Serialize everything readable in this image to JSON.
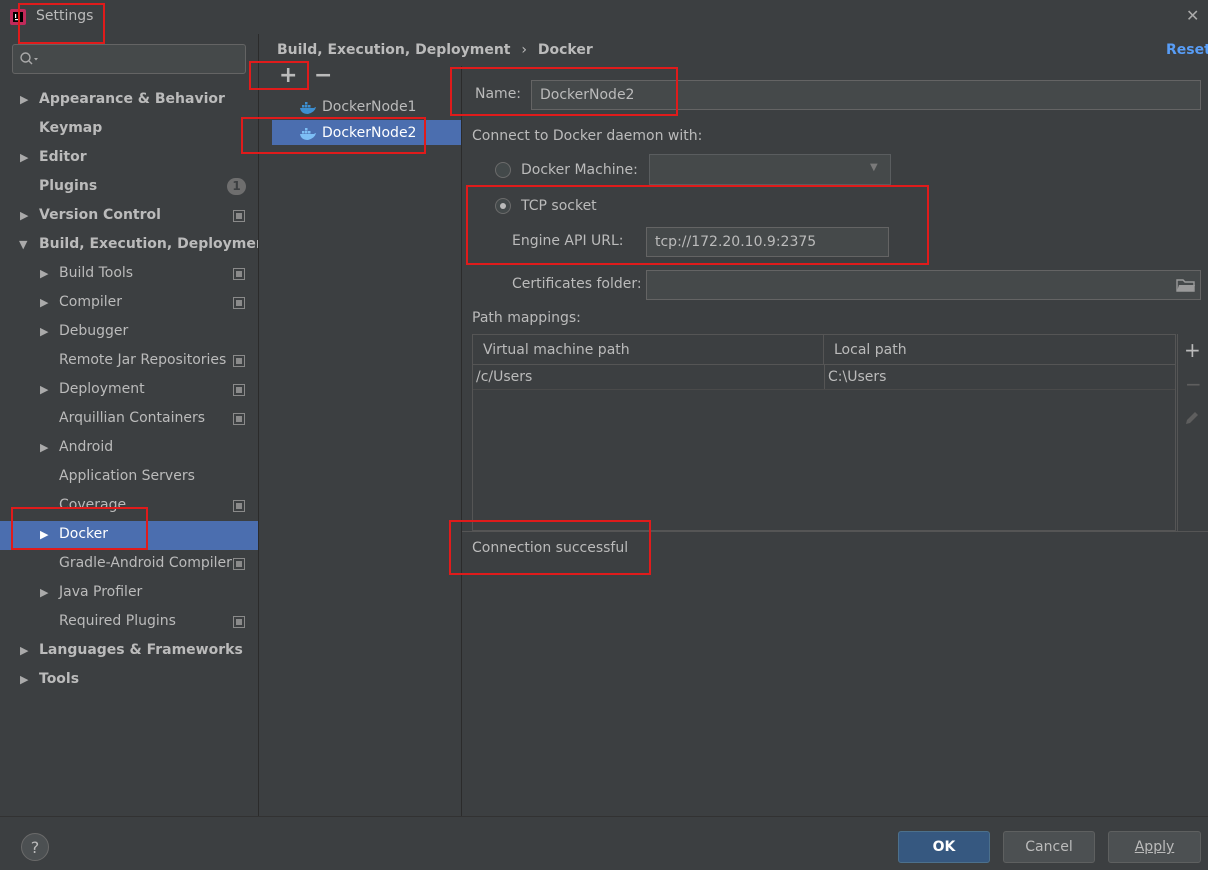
{
  "window": {
    "title": "Settings",
    "close_glyph": "✕"
  },
  "search": {
    "placeholder": ""
  },
  "sidebar": {
    "items": [
      {
        "label": "Appearance & Behavior",
        "expandable": true
      },
      {
        "label": "Keymap"
      },
      {
        "label": "Editor",
        "expandable": true
      },
      {
        "label": "Plugins",
        "badge": "1"
      },
      {
        "label": "Version Control",
        "expandable": true
      },
      {
        "label": "Build, Execution, Deployment",
        "expanded": true
      },
      {
        "label": "Build Tools",
        "expandable": true
      },
      {
        "label": "Compiler",
        "expandable": true
      },
      {
        "label": "Debugger",
        "expandable": true
      },
      {
        "label": "Remote Jar Repositories"
      },
      {
        "label": "Deployment",
        "expandable": true
      },
      {
        "label": "Arquillian Containers"
      },
      {
        "label": "Android",
        "expandable": true
      },
      {
        "label": "Application Servers"
      },
      {
        "label": "Coverage"
      },
      {
        "label": "Docker",
        "expandable": true,
        "selected": true
      },
      {
        "label": "Gradle-Android Compiler"
      },
      {
        "label": "Java Profiler",
        "expandable": true
      },
      {
        "label": "Required Plugins"
      },
      {
        "label": "Languages & Frameworks",
        "expandable": true
      },
      {
        "label": "Tools",
        "expandable": true
      }
    ]
  },
  "breadcrumb": {
    "parent": "Build, Execution, Deployment",
    "separator": "›",
    "current": "Docker"
  },
  "reset_label": "Reset",
  "toolbar": {
    "add": "+",
    "remove": "−"
  },
  "nodes": [
    {
      "label": "DockerNode1"
    },
    {
      "label": "DockerNode2",
      "selected": true
    }
  ],
  "form": {
    "name_label": "Name:",
    "name_value": "DockerNode2",
    "connect_label": "Connect to Docker daemon with:",
    "docker_machine_label": "Docker Machine:",
    "docker_machine_value": "",
    "tcp_label": "TCP socket",
    "engine_api_label": "Engine API URL:",
    "engine_api_value": "tcp://172.20.10.9:2375",
    "certs_label": "Certificates folder:",
    "certs_value": "",
    "path_mappings_label": "Path mappings:"
  },
  "path_table": {
    "columns": [
      "Virtual machine path",
      "Local path"
    ],
    "rows": [
      [
        "/c/Users",
        "C:\\Users"
      ]
    ]
  },
  "status": "Connection successful",
  "buttons": {
    "ok": "OK",
    "cancel": "Cancel",
    "apply": "Apply",
    "help": "?"
  },
  "colors": {
    "accent": "#4b6eaf",
    "link": "#589df6",
    "highlight": "#e01b1b",
    "ok_bg": "#365880"
  }
}
